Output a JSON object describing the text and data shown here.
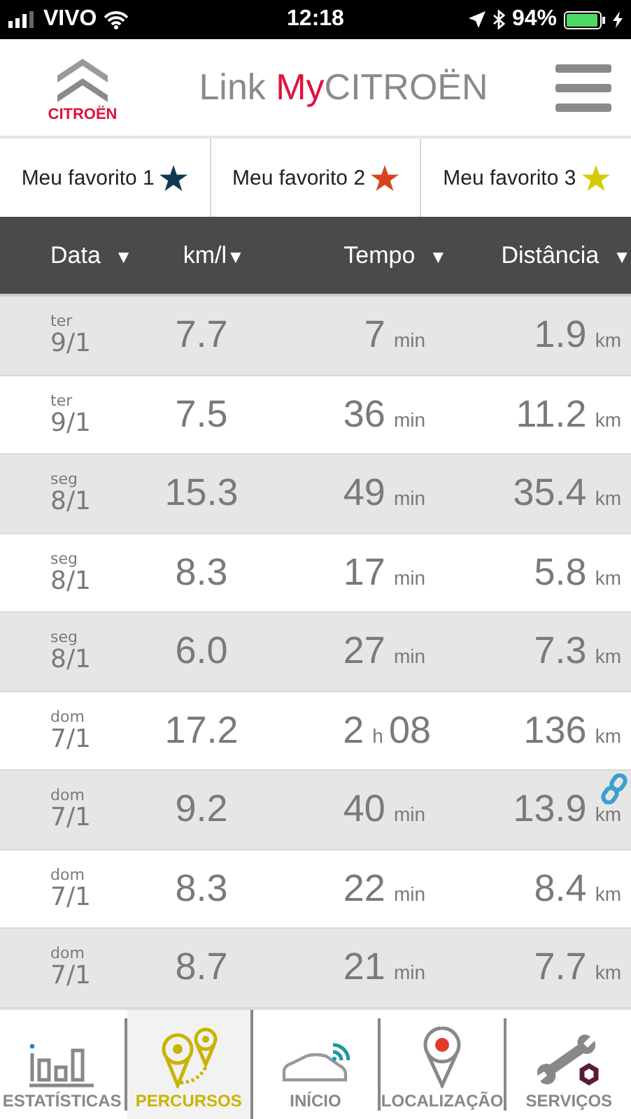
{
  "status_bar": {
    "carrier": "VIVO",
    "time": "12:18",
    "battery": "94%"
  },
  "header": {
    "logo_text": "CITROËN",
    "title": {
      "prefix": "Link",
      "accent": "My",
      "suffix": "CITROËN"
    }
  },
  "favorites": [
    {
      "label": "Meu favorito 1",
      "color": "#0e3a4f"
    },
    {
      "label": "Meu favorito 2",
      "color": "#d9441e"
    },
    {
      "label": "Meu favorito 3",
      "color": "#d4cc00"
    }
  ],
  "table": {
    "columns": [
      {
        "label": "Data",
        "arrow": "▼"
      },
      {
        "label": "km/l",
        "arrow": "▼"
      },
      {
        "label": "Tempo",
        "arrow": "▼"
      },
      {
        "label": "Distância",
        "arrow": "▼"
      }
    ],
    "rows": [
      {
        "day": "ter",
        "date": "9/1",
        "kml": "7.7",
        "time": "7",
        "time_unit": "min",
        "distance": "1.9",
        "distance_unit": "km",
        "linked": false
      },
      {
        "day": "ter",
        "date": "9/1",
        "kml": "7.5",
        "time": "36",
        "time_unit": "min",
        "distance": "11.2",
        "distance_unit": "km",
        "linked": false
      },
      {
        "day": "seg",
        "date": "8/1",
        "kml": "15.3",
        "time": "49",
        "time_unit": "min",
        "distance": "35.4",
        "distance_unit": "km",
        "linked": false
      },
      {
        "day": "seg",
        "date": "8/1",
        "kml": "8.3",
        "time": "17",
        "time_unit": "min",
        "distance": "5.8",
        "distance_unit": "km",
        "linked": false
      },
      {
        "day": "seg",
        "date": "8/1",
        "kml": "6.0",
        "time": "27",
        "time_unit": "min",
        "distance": "7.3",
        "distance_unit": "km",
        "linked": false
      },
      {
        "day": "dom",
        "date": "7/1",
        "kml": "17.2",
        "time": "2",
        "hours_unit": "h",
        "minutes": "08",
        "distance": "136",
        "distance_unit": "km",
        "linked": false
      },
      {
        "day": "dom",
        "date": "7/1",
        "kml": "9.2",
        "time": "40",
        "time_unit": "min",
        "distance": "13.9",
        "distance_unit": "km",
        "linked": true
      },
      {
        "day": "dom",
        "date": "7/1",
        "kml": "8.3",
        "time": "22",
        "time_unit": "min",
        "distance": "8.4",
        "distance_unit": "km",
        "linked": false
      },
      {
        "day": "dom",
        "date": "7/1",
        "kml": "8.7",
        "time": "21",
        "time_unit": "min",
        "distance": "7.7",
        "distance_unit": "km",
        "linked": false
      }
    ]
  },
  "tabs": [
    {
      "label": "ESTATÍSTICAS",
      "kind": "stats",
      "selected": false
    },
    {
      "label": "PERCURSOS",
      "kind": "routes",
      "selected": true
    },
    {
      "label": "INÍCIO",
      "kind": "home",
      "selected": false
    },
    {
      "label": "LOCALIZAÇÃO",
      "kind": "location",
      "selected": false
    },
    {
      "label": "SERVIÇOS",
      "kind": "services",
      "selected": false
    }
  ]
}
